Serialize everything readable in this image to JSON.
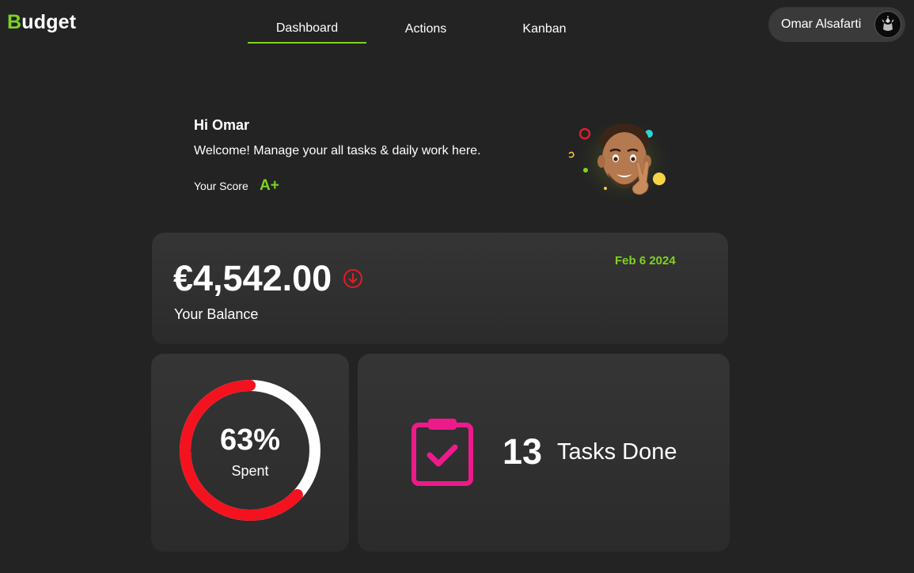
{
  "app": {
    "logo_initial": "B",
    "logo_rest": "udget"
  },
  "nav": {
    "tabs": [
      {
        "label": "Dashboard",
        "active": true
      },
      {
        "label": "Actions",
        "active": false
      },
      {
        "label": "Kanban",
        "active": false
      }
    ]
  },
  "user": {
    "name": "Omar Alsafarti",
    "avatar_icon": "user-avatar"
  },
  "greeting": {
    "title": "Hi Omar",
    "message": "Welcome! Manage your all tasks & daily work here.",
    "score_label": "Your Score",
    "score_value": "A+"
  },
  "balance": {
    "amount": "€4,542.00",
    "label": "Your Balance",
    "date": "Feb 6 2024",
    "trend_icon": "arrow-down-circle-icon"
  },
  "spent": {
    "percent_text": "63%",
    "percent_value": 63,
    "label": "Spent"
  },
  "tasks": {
    "count": "13",
    "label": "Tasks Done",
    "icon": "clipboard-check-icon"
  },
  "colors": {
    "accent": "#7ed321",
    "background": "#232323",
    "spent_ring": "#f4121f",
    "remaining_ring": "#ffffff",
    "tasks_icon": "#ee1a8c",
    "trend_down": "#e51a24"
  }
}
